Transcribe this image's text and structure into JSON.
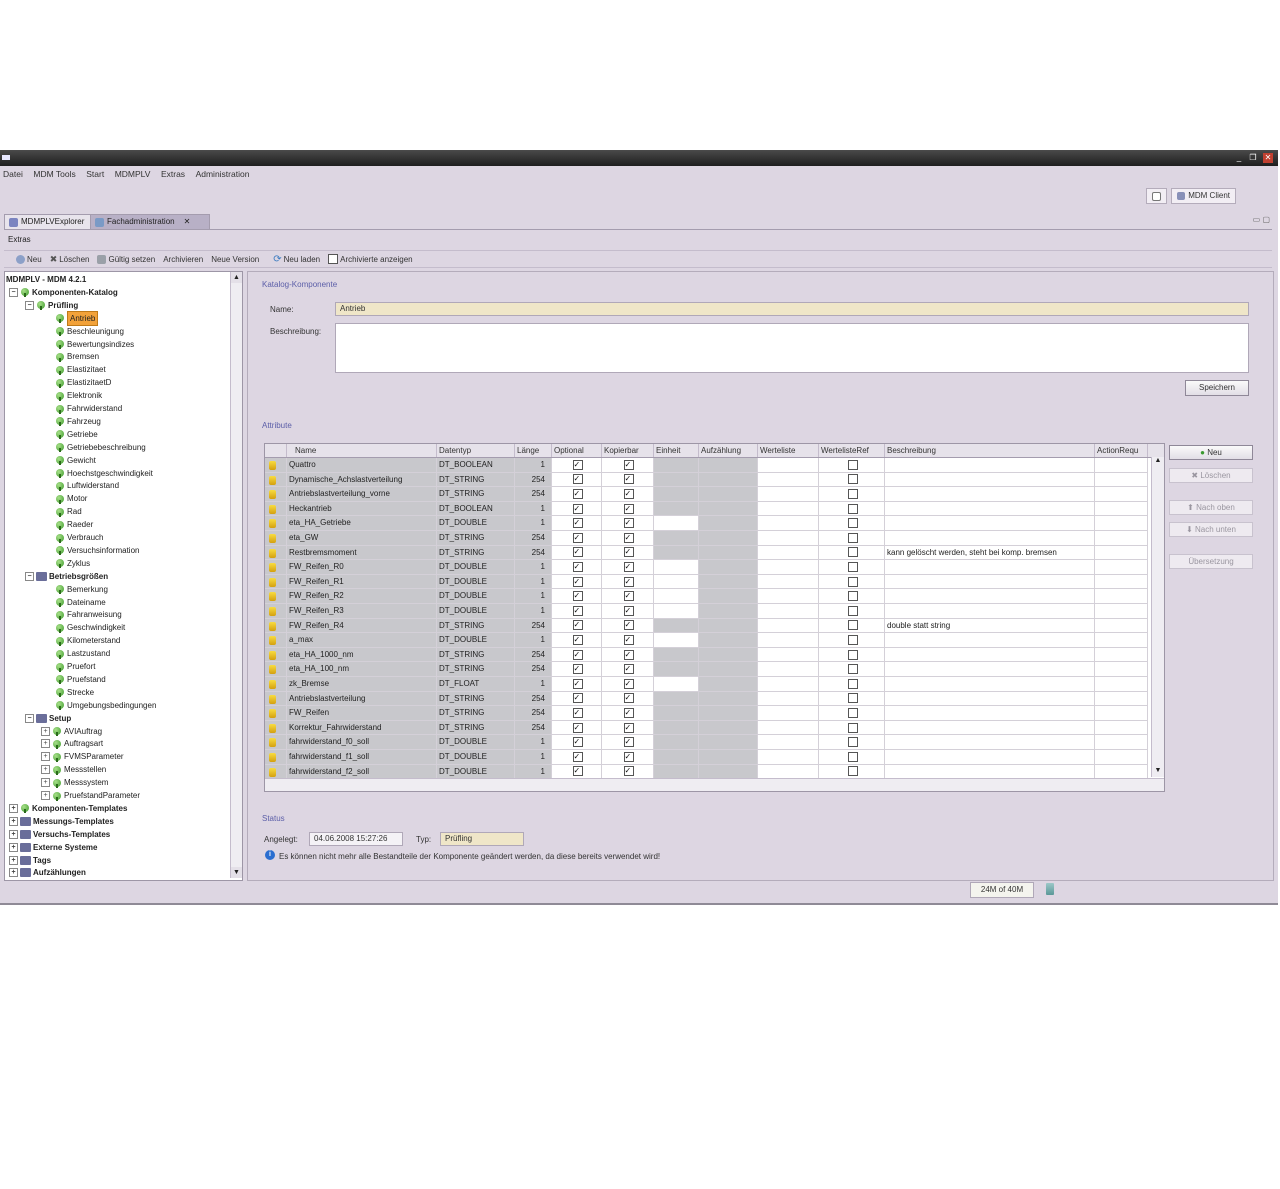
{
  "window": {
    "minimize": "_",
    "restore": "❐",
    "close": "✕"
  },
  "menu": [
    "Datei",
    "MDM Tools",
    "Start",
    "MDMPLV",
    "Extras",
    "Administration"
  ],
  "perspective": {
    "client_label": "MDM Client"
  },
  "tabs": [
    {
      "label": "MDMPLVExplorer"
    },
    {
      "label": "Fachadministration",
      "close": "✕"
    }
  ],
  "extras_label": "Extras",
  "toolbar": {
    "neu": "Neu",
    "loeschen": "Löschen",
    "gueltig": "Gültig setzen",
    "archivieren": "Archivieren",
    "neue_version": "Neue Version",
    "neu_laden": "Neu laden",
    "archivierte": "Archivierte anzeigen"
  },
  "tree": {
    "root": "MDMPLV - MDM 4.2.1",
    "komponenten_katalog": "Komponenten-Katalog",
    "pruefling": "Prüfling",
    "pruefling_items": [
      "Antrieb",
      "Beschleunigung",
      "Bewertungsindizes",
      "Bremsen",
      "Elastizitaet",
      "ElastizitaetD",
      "Elektronik",
      "Fahrwiderstand",
      "Fahrzeug",
      "Getriebe",
      "Getriebebeschreibung",
      "Gewicht",
      "Hoechstgeschwindigkeit",
      "Luftwiderstand",
      "Motor",
      "Rad",
      "Raeder",
      "Verbrauch",
      "Versuchsinformation",
      "Zyklus"
    ],
    "betriebsgroessen": "Betriebsgrößen",
    "betrieb_items": [
      "Bemerkung",
      "Dateiname",
      "Fahranweisung",
      "Geschwindigkeit",
      "Kilometerstand",
      "Lastzustand",
      "Pruefort",
      "Pruefstand",
      "Strecke",
      "Umgebungsbedingungen"
    ],
    "setup": "Setup",
    "setup_items": [
      "AVIAuftrag",
      "Auftragsart",
      "FVMSParameter",
      "Messstellen",
      "Messsystem",
      "PruefstandParameter"
    ],
    "bottom_items": [
      "Komponenten-Templates",
      "Messungs-Templates",
      "Versuchs-Templates",
      "Externe Systeme",
      "Tags",
      "Aufzählungen"
    ]
  },
  "detail": {
    "section_title": "Katalog-Komponente",
    "name_label": "Name:",
    "name_value": "Antrieb",
    "beschreibung_label": "Beschreibung:",
    "beschreibung_value": "",
    "save_button": "Speichern",
    "attribute_title": "Attribute"
  },
  "grid": {
    "columns": [
      "Name",
      "Datentyp",
      "Länge",
      "Optional",
      "Kopierbar",
      "Einheit",
      "Aufzählung",
      "Werteliste",
      "WertelisteRef",
      "Beschreibung",
      "ActionRequ"
    ],
    "rows": [
      {
        "name": "Quattro",
        "type": "DT_BOOLEAN",
        "len": "1",
        "opt": true,
        "kop": true,
        "einheit_white": false,
        "desc": ""
      },
      {
        "name": "Dynamische_Achslastverteilung",
        "type": "DT_STRING",
        "len": "254",
        "opt": true,
        "kop": true,
        "einheit_white": false,
        "desc": ""
      },
      {
        "name": "Antriebslastverteilung_vorne",
        "type": "DT_STRING",
        "len": "254",
        "opt": true,
        "kop": true,
        "einheit_white": false,
        "desc": ""
      },
      {
        "name": "Heckantrieb",
        "type": "DT_BOOLEAN",
        "len": "1",
        "opt": true,
        "kop": true,
        "einheit_white": false,
        "desc": ""
      },
      {
        "name": "eta_HA_Getriebe",
        "type": "DT_DOUBLE",
        "len": "1",
        "opt": true,
        "kop": true,
        "einheit_white": true,
        "desc": ""
      },
      {
        "name": "eta_GW",
        "type": "DT_STRING",
        "len": "254",
        "opt": true,
        "kop": true,
        "einheit_white": false,
        "desc": ""
      },
      {
        "name": "Restbremsmoment",
        "type": "DT_STRING",
        "len": "254",
        "opt": true,
        "kop": true,
        "einheit_white": false,
        "desc": "kann gelöscht werden, steht bei komp. bremsen"
      },
      {
        "name": "FW_Reifen_R0",
        "type": "DT_DOUBLE",
        "len": "1",
        "opt": true,
        "kop": true,
        "einheit_white": true,
        "desc": ""
      },
      {
        "name": "FW_Reifen_R1",
        "type": "DT_DOUBLE",
        "len": "1",
        "opt": true,
        "kop": true,
        "einheit_white": true,
        "desc": ""
      },
      {
        "name": "FW_Reifen_R2",
        "type": "DT_DOUBLE",
        "len": "1",
        "opt": true,
        "kop": true,
        "einheit_white": true,
        "desc": ""
      },
      {
        "name": "FW_Reifen_R3",
        "type": "DT_DOUBLE",
        "len": "1",
        "opt": true,
        "kop": true,
        "einheit_white": true,
        "desc": ""
      },
      {
        "name": "FW_Reifen_R4",
        "type": "DT_STRING",
        "len": "254",
        "opt": true,
        "kop": true,
        "einheit_white": false,
        "desc": "double statt string"
      },
      {
        "name": "a_max",
        "type": "DT_DOUBLE",
        "len": "1",
        "opt": true,
        "kop": true,
        "einheit_white": true,
        "desc": ""
      },
      {
        "name": "eta_HA_1000_nm",
        "type": "DT_STRING",
        "len": "254",
        "opt": true,
        "kop": true,
        "einheit_white": false,
        "desc": ""
      },
      {
        "name": "eta_HA_100_nm",
        "type": "DT_STRING",
        "len": "254",
        "opt": true,
        "kop": true,
        "einheit_white": false,
        "desc": ""
      },
      {
        "name": "zk_Bremse",
        "type": "DT_FLOAT",
        "len": "1",
        "opt": true,
        "kop": true,
        "einheit_white": true,
        "desc": ""
      },
      {
        "name": "Antriebslastverteilung",
        "type": "DT_STRING",
        "len": "254",
        "opt": true,
        "kop": true,
        "einheit_white": false,
        "desc": ""
      },
      {
        "name": "FW_Reifen",
        "type": "DT_STRING",
        "len": "254",
        "opt": true,
        "kop": true,
        "einheit_white": false,
        "desc": ""
      },
      {
        "name": "Korrektur_Fahrwiderstand",
        "type": "DT_STRING",
        "len": "254",
        "opt": true,
        "kop": true,
        "einheit_white": false,
        "desc": ""
      },
      {
        "name": "fahrwiderstand_f0_soll",
        "type": "DT_DOUBLE",
        "len": "1",
        "opt": true,
        "kop": true,
        "einheit_white": false,
        "desc": ""
      },
      {
        "name": "fahrwiderstand_f1_soll",
        "type": "DT_DOUBLE",
        "len": "1",
        "opt": true,
        "kop": true,
        "einheit_white": false,
        "desc": ""
      },
      {
        "name": "fahrwiderstand_f2_soll",
        "type": "DT_DOUBLE",
        "len": "1",
        "opt": true,
        "kop": true,
        "einheit_white": false,
        "desc": ""
      }
    ]
  },
  "side_buttons": {
    "neu": "Neu",
    "loeschen": "Löschen",
    "nach_oben": "Nach oben",
    "nach_unten": "Nach unten",
    "uebersetzung": "Übersetzung"
  },
  "status": {
    "title": "Status",
    "angelegt_label": "Angelegt:",
    "angelegt_value": "04.06.2008 15:27:26",
    "typ_label": "Typ:",
    "typ_value": "Prüfling",
    "info": "Es können nicht mehr alle Bestandteile der Komponente geändert werden, da diese bereits verwendet wird!"
  },
  "heap": "24M of 40M",
  "colors": {
    "accent": "#5b5ea8",
    "selection": "#f2a23a",
    "background": "#ddd6e2"
  }
}
